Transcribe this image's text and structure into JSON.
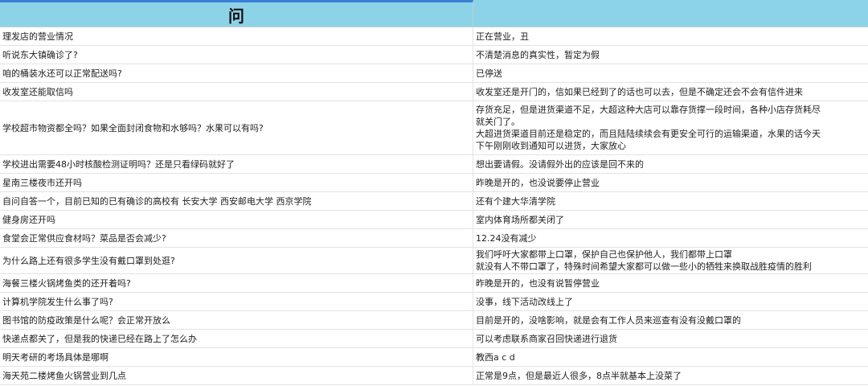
{
  "header": {
    "question": "问",
    "answer": ""
  },
  "rows": [
    {
      "q": "理发店的营业情况",
      "a": "正在营业，丑"
    },
    {
      "q": "听说东大镇确诊了?",
      "a": "不清楚消息的真实性，暂定为假"
    },
    {
      "q": "咱的桶装水还可以正常配送吗?",
      "a": "已停送"
    },
    {
      "q": "收发室还能取信吗",
      "a": "收发室还是开门的，信如果已经到了的话也可以去，但是不确定还会不会有信件进来"
    },
    {
      "q": "学校超市物资都全吗？如果全面封闭食物和水够吗？水果可以有吗?",
      "a": "存货充足，但是进货渠道不足，大超这种大店可以靠存货撑一段时间，各种小店存货耗尽\n就关门了。\n大超进货渠道目前还是稳定的，而且陆陆续续会有更安全可行的运输渠道，水果的话今天\n下午刚刚收到通知可以进货，大家放心"
    },
    {
      "q": "学校进出需要48小时核酸检测证明吗？还是只看绿码就好了",
      "a": "想出要请假。没请假外出的应该是回不来的"
    },
    {
      "q": "星南三楼夜市还开吗",
      "a": "昨晚是开的，也没说要停止营业"
    },
    {
      "q": "自问自答一个，目前已知的已有确诊的高校有 长安大学 西安邮电大学 西京学院",
      "a": "还有个建大华清学院"
    },
    {
      "q": "健身房还开吗",
      "a": "室内体育场所都关闭了"
    },
    {
      "q": "食堂会正常供应食材吗？菜品是否会减少?",
      "a": "12.24没有减少"
    },
    {
      "q": "为什么路上还有很多学生没有戴口罩到处逛?",
      "a": "我们呼吁大家都带上口罩，保护自己也保护他人，我们都带上口罩\n就没有人不带口罩了，特殊时间希望大家都可以做一些小的牺牲来换取战胜疫情的胜利"
    },
    {
      "q": "海餐三楼火锅烤鱼类的还开着吗?",
      "a": "昨晚是开的，也没有说暂停营业"
    },
    {
      "q": "计算机学院发生什么事了吗?",
      "a": "没事，线下活动改线上了"
    },
    {
      "q": "图书馆的防疫政策是什么呢？会正常开放么",
      "a": "目前是开的，没啥影响，就是会有工作人员来巡查有没有没戴口罩的"
    },
    {
      "q": "快递点都关了，但是我的快递已经在路上了怎么办",
      "a": "可以考虑联系商家召回快递进行退货"
    },
    {
      "q": "明天考研的考场具体是哪啊",
      "a": "教西a c d"
    },
    {
      "q": "海天苑二楼烤鱼火锅营业到几点",
      "a": "正常是9点，但是最近人很多，8点半就基本上没菜了"
    }
  ]
}
